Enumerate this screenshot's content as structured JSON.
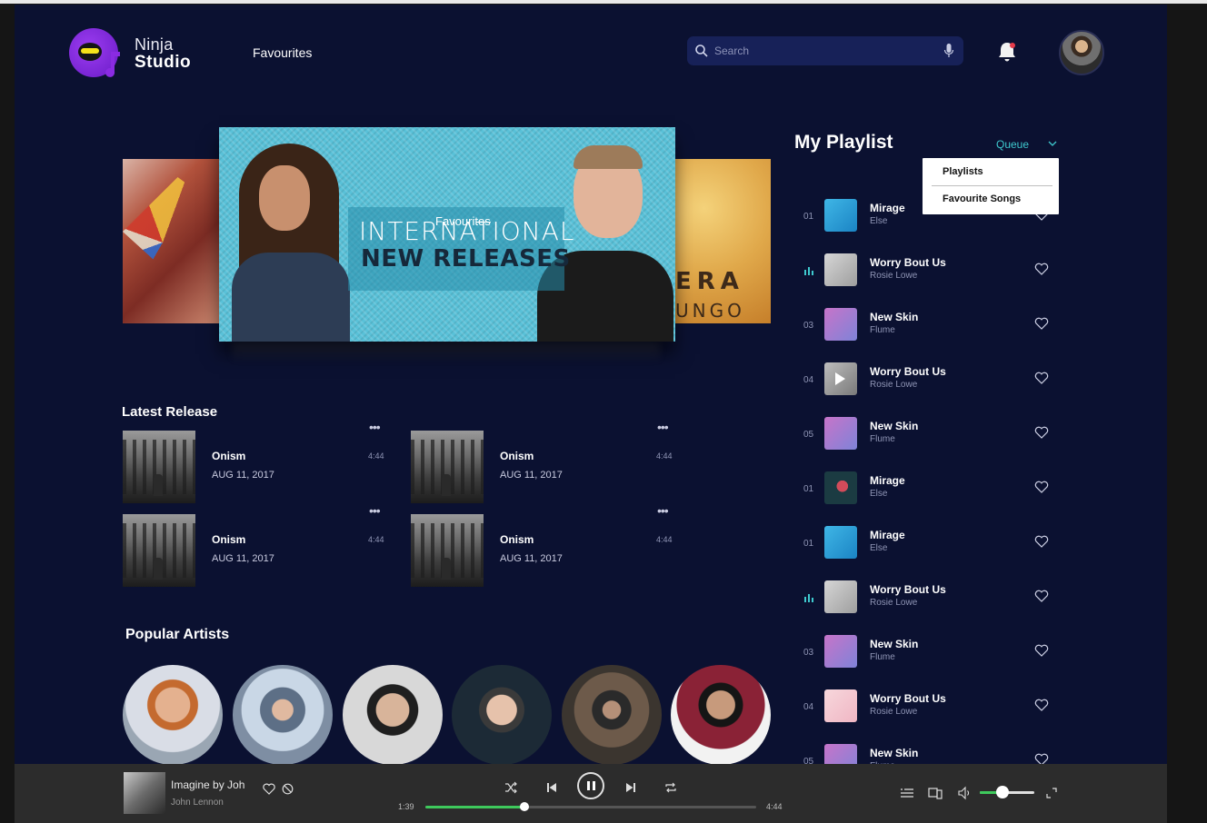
{
  "app": {
    "brand_line1": "Ninja",
    "brand_line2": "Studio",
    "nav_favourites": "Favourites",
    "search_placeholder": "Search",
    "colors": {
      "background": "#0b1131",
      "accent": "#3ec9ce",
      "progress": "#3ec95c",
      "player_bar": "#2c2c2c"
    }
  },
  "banner": {
    "overlay_label": "Favourites",
    "line1": "INTERNATIONAL",
    "line2": "NEW RELEASES",
    "right_partial_line1": "ERA",
    "right_partial_line2": "UNGO"
  },
  "playlist": {
    "title": "My Playlist",
    "queue_label": "Queue",
    "dropdown": [
      "Playlists",
      "Favourite Songs"
    ],
    "rows": [
      {
        "num": "01",
        "song": "Mirage",
        "artist": "Else",
        "playing": false,
        "art": "mirage-blue"
      },
      {
        "num": "",
        "song": "Worry Bout Us",
        "artist": "Rosie Lowe",
        "playing": true,
        "art": "grey"
      },
      {
        "num": "03",
        "song": "New Skin",
        "artist": "Flume",
        "playing": false,
        "art": "pink"
      },
      {
        "num": "04",
        "song": "Worry Bout Us",
        "artist": "Rosie Lowe",
        "playing": false,
        "art": "grey-play"
      },
      {
        "num": "05",
        "song": "New Skin",
        "artist": "Flume",
        "playing": false,
        "art": "pink"
      },
      {
        "num": "01",
        "song": "Mirage",
        "artist": "Else",
        "playing": false,
        "art": "mirage-dark"
      },
      {
        "num": "01",
        "song": "Mirage",
        "artist": "Else",
        "playing": false,
        "art": "mirage-blue"
      },
      {
        "num": "",
        "song": "Worry Bout Us",
        "artist": "Rosie Lowe",
        "playing": true,
        "art": "grey"
      },
      {
        "num": "03",
        "song": "New Skin",
        "artist": "Flume",
        "playing": false,
        "art": "pink"
      },
      {
        "num": "04",
        "song": "Worry Bout Us",
        "artist": "Rosie Lowe",
        "playing": false,
        "art": "light-pink"
      },
      {
        "num": "05",
        "song": "New Skin",
        "artist": "Flume",
        "playing": false,
        "art": "pink"
      }
    ]
  },
  "latest_release": {
    "title": "Latest Release",
    "items": [
      {
        "song": "Onism",
        "date": "AUG 11, 2017",
        "duration": "4:44"
      },
      {
        "song": "Onism",
        "date": "AUG 11, 2017",
        "duration": "4:44"
      },
      {
        "song": "Onism",
        "date": "AUG 11, 2017",
        "duration": "4:44"
      },
      {
        "song": "Onism",
        "date": "AUG 11, 2017",
        "duration": "4:44"
      }
    ]
  },
  "popular_artists": {
    "title": "Popular Artists",
    "count": 6
  },
  "player": {
    "title": "Imagine by Joh",
    "artist": "John Lennon",
    "current_time": "1:39",
    "total_time": "4:44",
    "progress_fraction": 0.3,
    "volume_fraction": 0.42,
    "state": "playing"
  }
}
